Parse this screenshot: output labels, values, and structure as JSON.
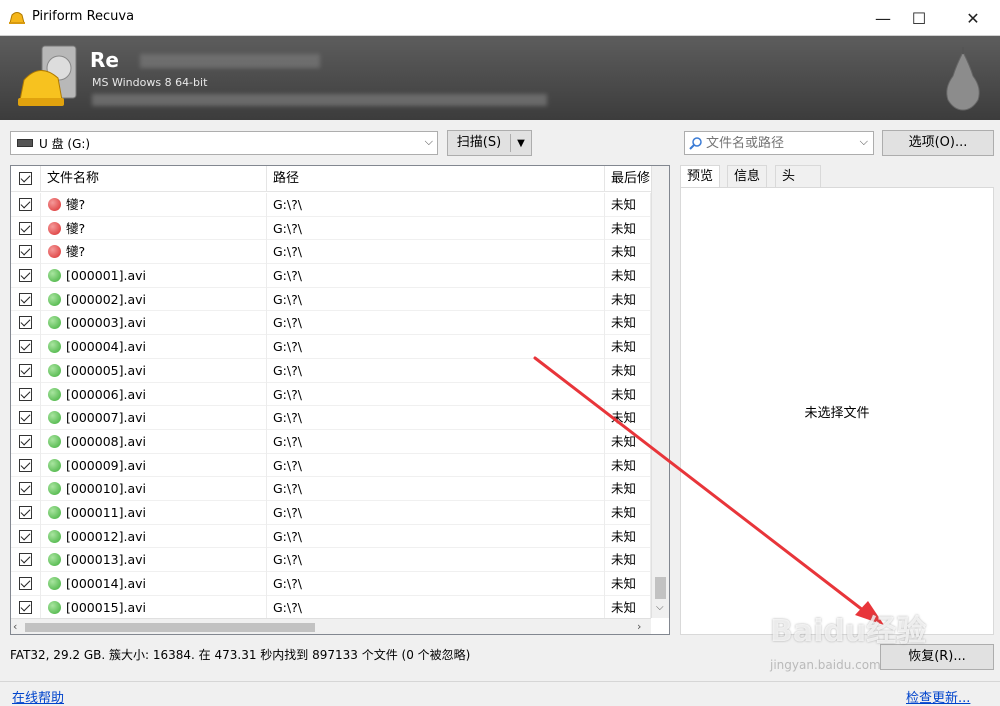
{
  "window": {
    "title": "Piriform Recuva",
    "minimize": "—",
    "maximize": "☐",
    "close": "✕"
  },
  "header": {
    "app_name": "Re",
    "system_info": "MS Windows 8 64-bit"
  },
  "toolbar": {
    "drive": "U 盘 (G:)",
    "scan_label": "扫描(S)",
    "search_placeholder": "文件名或路径",
    "options_label": "选项(O)..."
  },
  "table": {
    "columns": [
      "文件名称",
      "路径",
      "最后修"
    ],
    "rows": [
      {
        "name": "犪?",
        "path": "G:\\?\\",
        "modified": "未知",
        "state": "red"
      },
      {
        "name": "犪?",
        "path": "G:\\?\\",
        "modified": "未知",
        "state": "red"
      },
      {
        "name": "犪?",
        "path": "G:\\?\\",
        "modified": "未知",
        "state": "red"
      },
      {
        "name": "[000001].avi",
        "path": "G:\\?\\",
        "modified": "未知",
        "state": "green"
      },
      {
        "name": "[000002].avi",
        "path": "G:\\?\\",
        "modified": "未知",
        "state": "green"
      },
      {
        "name": "[000003].avi",
        "path": "G:\\?\\",
        "modified": "未知",
        "state": "green"
      },
      {
        "name": "[000004].avi",
        "path": "G:\\?\\",
        "modified": "未知",
        "state": "green"
      },
      {
        "name": "[000005].avi",
        "path": "G:\\?\\",
        "modified": "未知",
        "state": "green"
      },
      {
        "name": "[000006].avi",
        "path": "G:\\?\\",
        "modified": "未知",
        "state": "green"
      },
      {
        "name": "[000007].avi",
        "path": "G:\\?\\",
        "modified": "未知",
        "state": "green"
      },
      {
        "name": "[000008].avi",
        "path": "G:\\?\\",
        "modified": "未知",
        "state": "green"
      },
      {
        "name": "[000009].avi",
        "path": "G:\\?\\",
        "modified": "未知",
        "state": "green"
      },
      {
        "name": "[000010].avi",
        "path": "G:\\?\\",
        "modified": "未知",
        "state": "green"
      },
      {
        "name": "[000011].avi",
        "path": "G:\\?\\",
        "modified": "未知",
        "state": "green"
      },
      {
        "name": "[000012].avi",
        "path": "G:\\?\\",
        "modified": "未知",
        "state": "green"
      },
      {
        "name": "[000013].avi",
        "path": "G:\\?\\",
        "modified": "未知",
        "state": "green"
      },
      {
        "name": "[000014].avi",
        "path": "G:\\?\\",
        "modified": "未知",
        "state": "green"
      },
      {
        "name": "[000015].avi",
        "path": "G:\\?\\",
        "modified": "未知",
        "state": "green"
      }
    ]
  },
  "tabs": [
    "预览",
    "信息",
    "头"
  ],
  "preview": {
    "message": "未选择文件"
  },
  "status": {
    "text": "FAT32, 29.2 GB. 簇大小: 16384. 在 473.31 秒内找到 897133 个文件 (0 个被忽略)"
  },
  "recover_label": "恢复(R)...",
  "footer": {
    "help_link": "在线帮助",
    "update_link": "检查更新..."
  },
  "watermark": {
    "brand": "Baidu经验",
    "url": "jingyan.baidu.com"
  },
  "colors": {
    "status_red": "#d92e2e",
    "status_green": "#3fae3a",
    "annotation_arrow": "#e8353a",
    "link": "#0044cc"
  }
}
